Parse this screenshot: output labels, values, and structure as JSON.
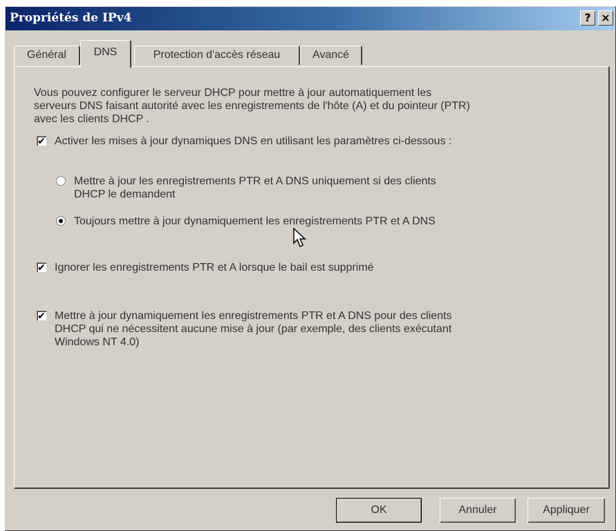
{
  "window": {
    "title": "Propriétés de IPv4",
    "help_label": "?",
    "close_label": "×"
  },
  "tabs": [
    {
      "label": "Général",
      "active": false
    },
    {
      "label": "DNS",
      "active": true
    },
    {
      "label": "Protection d'accès réseau",
      "active": false
    },
    {
      "label": "Avancé",
      "active": false
    }
  ],
  "dns": {
    "description": "Vous pouvez configurer le serveur DHCP pour mettre à jour automatiquement les serveurs DNS faisant autorité avec les enregistrements de l'hôte (A) et du pointeur (PTR) avec les clients DHCP .",
    "enable_dynamic_updates": {
      "label": "Activer les mises à jour dynamiques DNS en utilisant les paramètres ci-dessous :",
      "checked": true
    },
    "radio_on_request": {
      "label": "Mettre à jour les enregistrements PTR et A DNS uniquement si des clients DHCP le demandent",
      "selected": false
    },
    "radio_always": {
      "label": "Toujours mettre à jour dynamiquement les enregistrements PTR et A DNS",
      "selected": true
    },
    "discard_on_lease_delete": {
      "label": "Ignorer les enregistrements PTR et A lorsque le bail est supprimé",
      "checked": true
    },
    "update_for_non_requesting": {
      "label": "Mettre à jour dynamiquement les enregistrements PTR et A DNS pour des clients DHCP qui ne nécessitent aucune mise à jour (par exemple, des clients exécutant Windows NT 4.0)",
      "checked": true
    }
  },
  "buttons": {
    "ok": "OK",
    "cancel": "Annuler",
    "apply": "Appliquer"
  },
  "colors": {
    "dialog_bg": "#d4d0c8",
    "titlebar_start": "#0a246a",
    "titlebar_end": "#a6caf0"
  },
  "check_mark": "✔"
}
